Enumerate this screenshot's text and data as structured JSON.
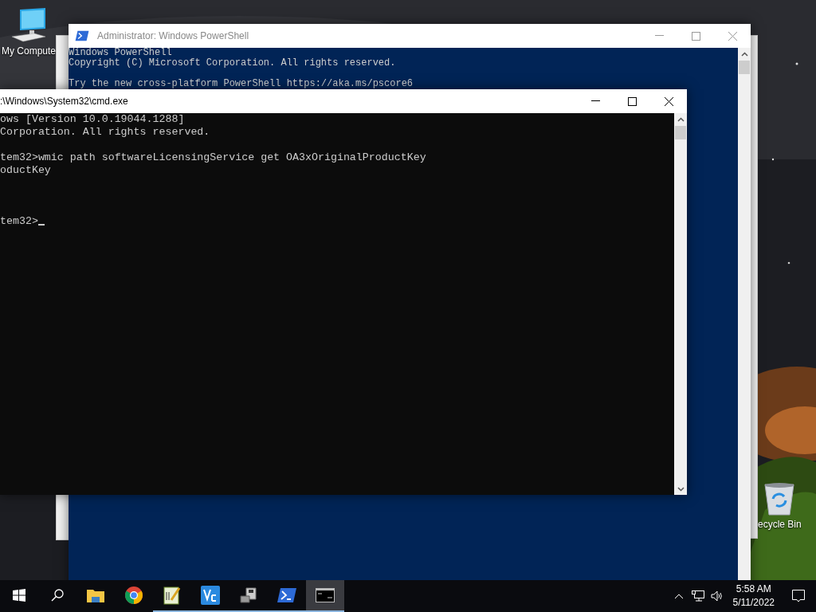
{
  "desktop_icons": [
    {
      "kind": "computer",
      "label": "My Compute"
    },
    {
      "kind": "recycle",
      "label": "ecycle Bin"
    }
  ],
  "powershell_window": {
    "title": "Administrator: Windows PowerShell",
    "blocks": [
      {
        "lines": [
          "Windows PowerShell",
          "Copyright (C) Microsoft Corporation. All rights reserved."
        ]
      },
      {
        "lines": [
          "Try the new cross-platform PowerShell https://aka.ms/pscore6"
        ]
      }
    ]
  },
  "cmd_window": {
    "title": ":\\Windows\\System32\\cmd.exe",
    "blocks": [
      {
        "kind": "banner",
        "lines": [
          "ows [Version 10.0.19044.1288]",
          "Corporation. All rights reserved."
        ]
      },
      {
        "kind": "output",
        "lines": [
          "tem32>wmic path softwareLicensingService get OA3xOriginalProductKey",
          "oductKey"
        ]
      },
      {
        "kind": "prompt",
        "lines": [
          "tem32>"
        ]
      }
    ],
    "cursor": true
  },
  "taskbar": {
    "apps": [
      {
        "kind": "explorer",
        "selected": false,
        "running": false
      },
      {
        "kind": "chrome",
        "selected": false,
        "running": false
      },
      {
        "kind": "notepad",
        "selected": false,
        "running": true
      },
      {
        "kind": "vnc",
        "selected": false,
        "running": true
      },
      {
        "kind": "setup",
        "selected": false,
        "running": true
      },
      {
        "kind": "powershell",
        "selected": false,
        "running": true
      },
      {
        "kind": "cmd",
        "selected": true,
        "running": true
      }
    ],
    "time": "5:58 AM",
    "date": "5/11/2022"
  }
}
